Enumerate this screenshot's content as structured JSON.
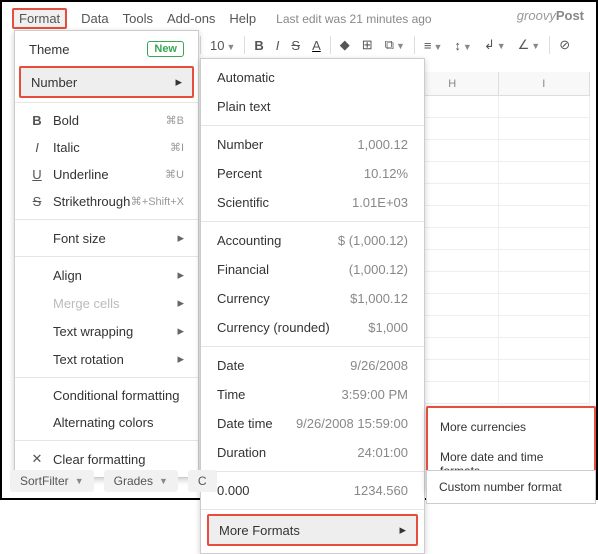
{
  "menubar": {
    "format": "Format",
    "data": "Data",
    "tools": "Tools",
    "addons": "Add-ons",
    "help": "Help",
    "edit_info": "Last edit was 21 minutes ago"
  },
  "brand": {
    "g": "groovy",
    "p": "Post"
  },
  "toolbar": {
    "font_size": "10",
    "bold": "B",
    "italic": "I",
    "strike": "S",
    "underline_text_color": "A"
  },
  "format_menu": {
    "theme": "Theme",
    "new_badge": "New",
    "number": "Number",
    "bold": "Bold",
    "bold_sc": "⌘B",
    "italic": "Italic",
    "italic_sc": "⌘I",
    "underline": "Underline",
    "underline_sc": "⌘U",
    "strike": "Strikethrough",
    "strike_sc": "⌘+Shift+X",
    "font_size": "Font size",
    "align": "Align",
    "merge": "Merge cells",
    "wrap": "Text wrapping",
    "rotate": "Text rotation",
    "cond": "Conditional formatting",
    "alt": "Alternating colors",
    "clear": "Clear formatting"
  },
  "number_menu": {
    "automatic": "Automatic",
    "plain": "Plain text",
    "number": "Number",
    "number_ex": "1,000.12",
    "percent": "Percent",
    "percent_ex": "10.12%",
    "scientific": "Scientific",
    "scientific_ex": "1.01E+03",
    "accounting": "Accounting",
    "accounting_ex": "$ (1,000.12)",
    "financial": "Financial",
    "financial_ex": "(1,000.12)",
    "currency": "Currency",
    "currency_ex": "$1,000.12",
    "currency_r": "Currency (rounded)",
    "currency_r_ex": "$1,000",
    "date": "Date",
    "date_ex": "9/26/2008",
    "time": "Time",
    "time_ex": "3:59:00 PM",
    "datetime": "Date time",
    "datetime_ex": "9/26/2008 15:59:00",
    "duration": "Duration",
    "duration_ex": "24:01:00",
    "zero": "0.000",
    "zero_ex": "1234.560",
    "more": "More Formats"
  },
  "more_menu": {
    "currencies": "More currencies",
    "datetime": "More date and time formats",
    "custom": "Custom number format"
  },
  "grid": {
    "colH": "H",
    "colI": "I"
  },
  "sheet_tabs": {
    "t1": "SortFilter",
    "t2": "Grades",
    "t3": "C"
  }
}
